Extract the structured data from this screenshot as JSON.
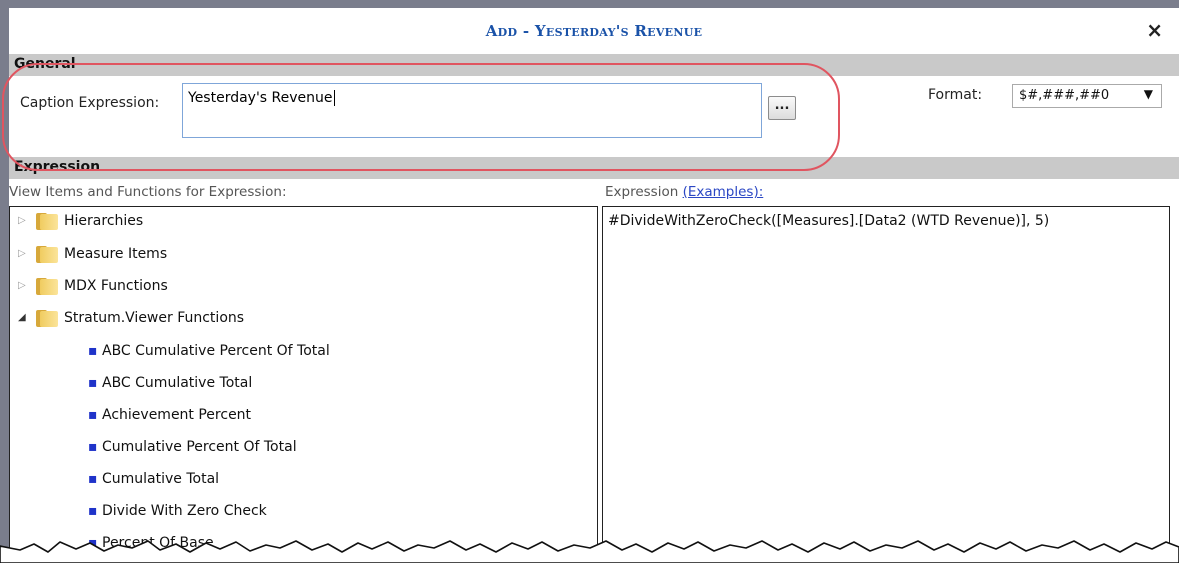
{
  "dialog": {
    "title": "Add - Yesterday's Revenue",
    "close_label": "×"
  },
  "general": {
    "section_label": "General",
    "caption_label": "Caption Expression:",
    "caption_value": "Yesterday's Revenue",
    "browse_label": "...",
    "format_label": "Format:",
    "format_value": "$#,###,##0",
    "format_arrow": "▼"
  },
  "expression": {
    "section_label": "Expression",
    "left_header": "View Items and Functions for Expression:",
    "right_header": "Expression",
    "examples_link": "(Examples):",
    "text": "#DivideWithZeroCheck([Measures].[Data2 (WTD Revenue)], 5)"
  },
  "tree": {
    "folders": [
      {
        "label": "Hierarchies",
        "expanded": false,
        "toggle": "▷"
      },
      {
        "label": "Measure Items",
        "expanded": false,
        "toggle": "▷"
      },
      {
        "label": "MDX Functions",
        "expanded": false,
        "toggle": "▷"
      },
      {
        "label": "Stratum.Viewer Functions",
        "expanded": true,
        "toggle": "◢"
      }
    ],
    "bullet": "▪",
    "functions": [
      "ABC Cumulative Percent Of Total",
      "ABC Cumulative Total",
      "Achievement Percent",
      "Cumulative Percent Of Total",
      "Cumulative Total",
      "Divide With Zero Check",
      "Percent Of Base"
    ]
  },
  "colors": {
    "title": "#1a52a8",
    "highlight": "#e05560",
    "bullet": "#1f33c9",
    "section_bar": "#c9c9c9"
  }
}
